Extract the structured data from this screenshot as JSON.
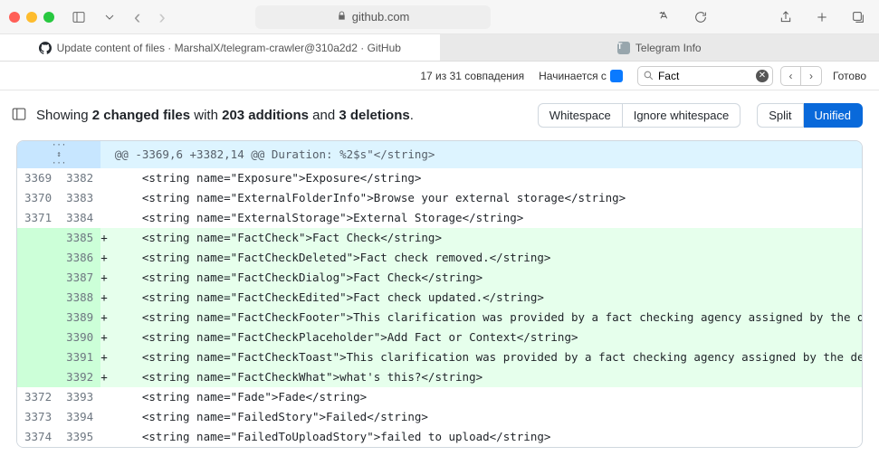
{
  "browser": {
    "address": "github.com",
    "tab1": "Update content of files · MarshalX/telegram-crawler@310a2d2 · GitHub",
    "tab2": "Telegram Info"
  },
  "find": {
    "matches": "17 из 31 совпадения",
    "mode_label": "Начинается с",
    "query": "Fact",
    "done": "Готово"
  },
  "toolbar": {
    "summary_prefix": "Showing ",
    "files": "2 changed files",
    "with": " with ",
    "additions": "203 additions",
    "and": " and ",
    "deletions": "3 deletions",
    "period": ".",
    "whitespace": "Whitespace",
    "ignore_ws": "Ignore whitespace",
    "split": "Split",
    "unified": "Unified"
  },
  "hunk": "@@ -3369,6 +3382,14 @@ Duration: %2$s\"</string>",
  "rows": [
    {
      "type": "ctx",
      "old": "3369",
      "new": "3382",
      "mark": "",
      "code": "    <string name=\"Exposure\">Exposure</string>"
    },
    {
      "type": "ctx",
      "old": "3370",
      "new": "3383",
      "mark": "",
      "code": "    <string name=\"ExternalFolderInfo\">Browse your external storage</string>"
    },
    {
      "type": "ctx",
      "old": "3371",
      "new": "3384",
      "mark": "",
      "code": "    <string name=\"ExternalStorage\">External Storage</string>"
    },
    {
      "type": "add",
      "old": "",
      "new": "3385",
      "mark": "+",
      "code": "    <string name=\"FactCheck\">Fact Check</string>"
    },
    {
      "type": "add",
      "old": "",
      "new": "3386",
      "mark": "+",
      "code": "    <string name=\"FactCheckDeleted\">Fact check removed.</string>"
    },
    {
      "type": "add",
      "old": "",
      "new": "3387",
      "mark": "+",
      "code": "    <string name=\"FactCheckDialog\">Fact Check</string>"
    },
    {
      "type": "add",
      "old": "",
      "new": "3388",
      "mark": "+",
      "code": "    <string name=\"FactCheckEdited\">Fact check updated.</string>"
    },
    {
      "type": "add",
      "old": "",
      "new": "3389",
      "mark": "+",
      "code": "    <string name=\"FactCheckFooter\">This clarification was provided by a fact checking agency assigned by the department of the government of your country (%s) responsible for combating misinformation.</string>"
    },
    {
      "type": "add",
      "old": "",
      "new": "3390",
      "mark": "+",
      "code": "    <string name=\"FactCheckPlaceholder\">Add Fact or Context</string>"
    },
    {
      "type": "add",
      "old": "",
      "new": "3391",
      "mark": "+",
      "code": "    <string name=\"FactCheckToast\">This clarification was provided by a fact checking agency assigned by the department of the government of your country (%s) responsible for combating misinformation.</string>"
    },
    {
      "type": "add",
      "old": "",
      "new": "3392",
      "mark": "+",
      "code": "    <string name=\"FactCheckWhat\">what's this?</string>"
    },
    {
      "type": "ctx",
      "old": "3372",
      "new": "3393",
      "mark": "",
      "code": "    <string name=\"Fade\">Fade</string>"
    },
    {
      "type": "ctx",
      "old": "3373",
      "new": "3394",
      "mark": "",
      "code": "    <string name=\"FailedStory\">Failed</string>"
    },
    {
      "type": "ctx",
      "old": "3374",
      "new": "3395",
      "mark": "",
      "code": "    <string name=\"FailedToUploadStory\">failed to upload</string>"
    }
  ]
}
